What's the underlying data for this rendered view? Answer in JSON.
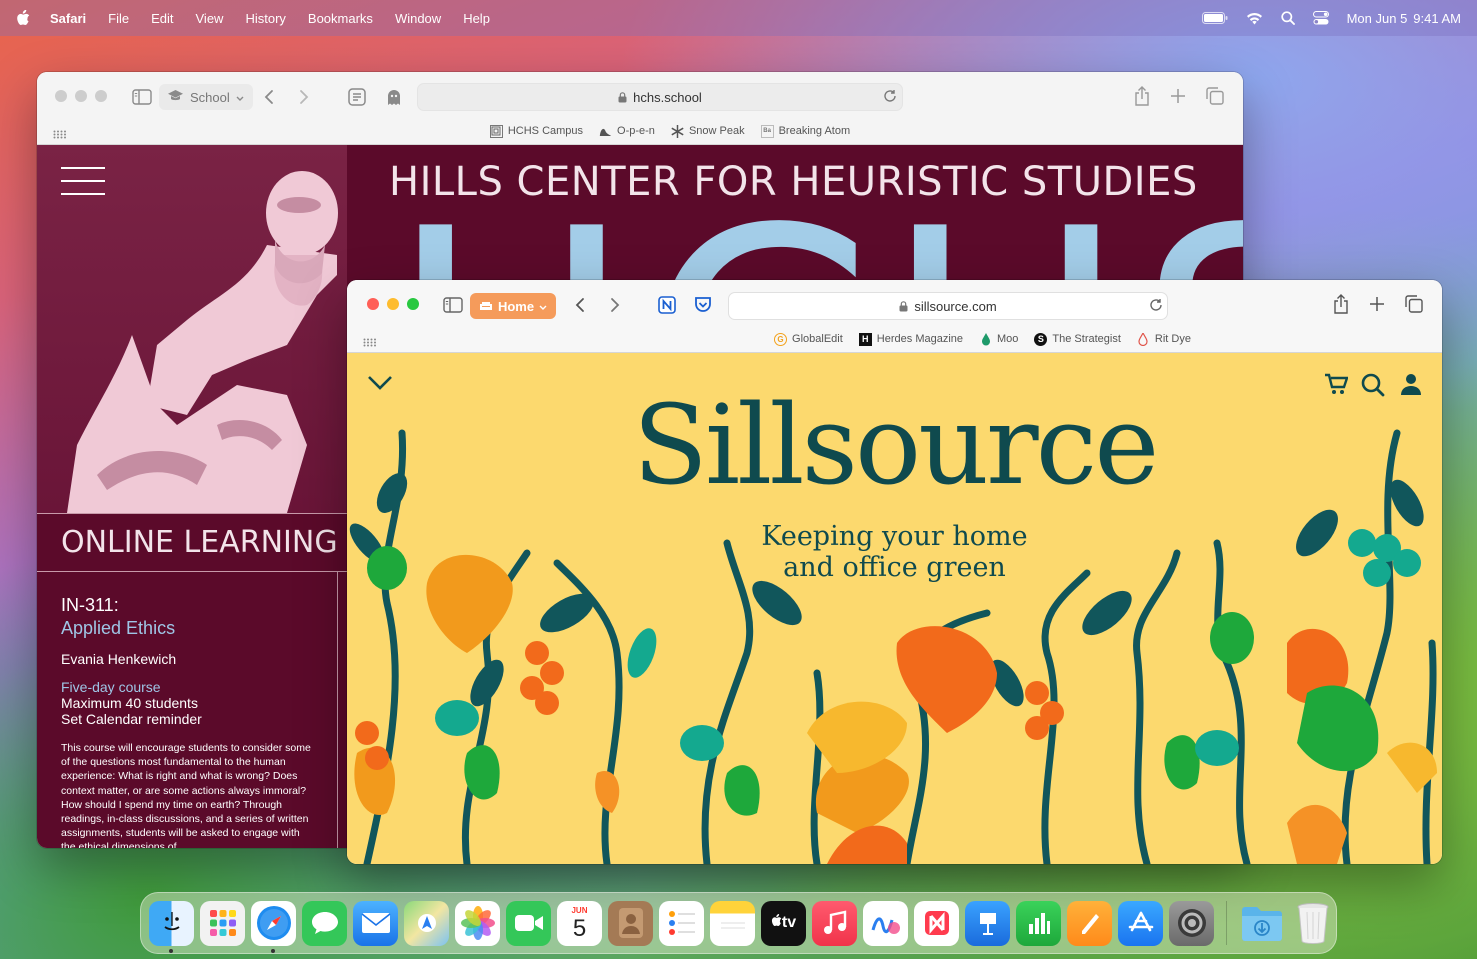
{
  "menubar": {
    "app_name": "Safari",
    "menus": [
      "File",
      "Edit",
      "View",
      "History",
      "Bookmarks",
      "Window",
      "Help"
    ],
    "date": "Mon Jun 5",
    "time": "9:41 AM"
  },
  "window_back": {
    "tab_group": "School",
    "url": "hchs.school",
    "favorites": [
      "HCHS Campus",
      "O-p-e-n",
      "Snow Peak",
      "Breaking Atom"
    ],
    "site": {
      "title": "HILLS CENTER FOR HEURISTIC STUDIES",
      "big_word": "HCHS",
      "section": "ONLINE LEARNING",
      "course_code": "IN-311:",
      "course_name": "Applied Ethics",
      "instructor": "Evania Henkewich",
      "duration": "Five-day course",
      "capacity": "Maximum 40 students",
      "calendar": "Set Calendar reminder",
      "description": "This course will encourage students to consider some of the questions most fundamental to the human experience: What is right and what is wrong? Does context matter, or are some actions always immoral? How should I spend my time on earth? Through readings, in-class discussions, and a series of written assignments, students will be asked to engage with the ethical dimensions of"
    }
  },
  "window_front": {
    "tab_group": "Home",
    "url": "sillsource.com",
    "favorites": [
      "GlobalEdit",
      "Herdes Magazine",
      "Moo",
      "The Strategist",
      "Rit Dye"
    ],
    "site": {
      "brand": "Sillsource",
      "tagline_1": "Keeping your home",
      "tagline_2": "and office green"
    }
  },
  "dock": {
    "apps": [
      "Finder",
      "Launchpad",
      "Safari",
      "Messages",
      "Mail",
      "Maps",
      "Photos",
      "FaceTime",
      "Calendar",
      "Contacts",
      "Reminders",
      "Notes",
      "TV",
      "Music",
      "Freeform",
      "News",
      "Keynote",
      "Numbers",
      "Pages",
      "App Store",
      "System Settings",
      "Downloads",
      "Trash"
    ],
    "calendar_month": "JUN",
    "calendar_day": "5",
    "tv_label": "tv"
  },
  "colors": {
    "hchs_bg": "#5b0a2a",
    "hchs_accent": "#9fc6e6",
    "sill_bg": "#fcd96e",
    "sill_ink": "#0f4a4e",
    "home_tab": "#f59b5b"
  }
}
